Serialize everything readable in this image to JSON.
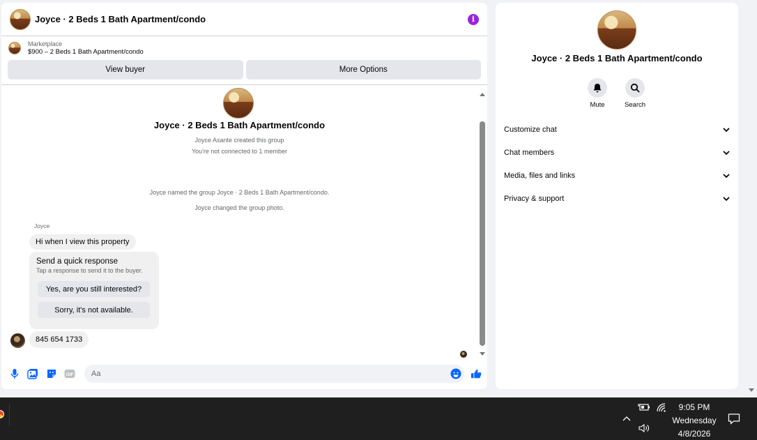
{
  "chat": {
    "header_title": "Joyce · 2 Beds 1 Bath Apartment/condo",
    "marketplace_source": "Marketplace",
    "marketplace_listing": "$900 – 2 Beds 1 Bath Apartment/condo",
    "view_buyer_label": "View buyer",
    "more_options_label": "More Options",
    "group_title": "Joyce · 2 Beds 1 Bath Apartment/condo",
    "created_by": "Joyce Asante created this group",
    "connection_status": "You're not connected to 1 member",
    "event_named": "Joyce named the group Joyce · 2 Beds 1 Bath Apartment/condo.",
    "event_photo": "Joyce changed the group photo.",
    "sender_name": "Joyce",
    "message_1": "Hi when I view this property",
    "quick_response_title": "Send a quick response",
    "quick_response_sub": "Tap a response to send it to the buyer.",
    "quick_option_1": "Yes, are you still interested?",
    "quick_option_2": "Sorry, it's not available.",
    "message_2": "845 654 1733",
    "input_placeholder": "Aa",
    "gif_label": "GIF"
  },
  "details": {
    "title": "Joyce · 2 Beds 1 Bath Apartment/condo",
    "mute_label": "Mute",
    "search_label": "Search",
    "sections": [
      "Customize chat",
      "Chat members",
      "Media, files and links",
      "Privacy & support"
    ]
  },
  "taskbar": {
    "time": "9:05 PM",
    "day": "Wednesday",
    "date": "4/8/2026"
  },
  "colors": {
    "accent_blue": "#0866ff",
    "info_purple": "#9b24d9",
    "taskbar_bg": "#1f1f1f"
  },
  "icons": [
    "info-icon",
    "mic-icon",
    "photo-icon",
    "sticker-icon",
    "gif-icon",
    "emoji-icon",
    "like-icon",
    "bell-icon",
    "search-icon",
    "chevron-down-icon",
    "battery-icon",
    "wifi-icon",
    "volume-icon",
    "notification-icon"
  ]
}
